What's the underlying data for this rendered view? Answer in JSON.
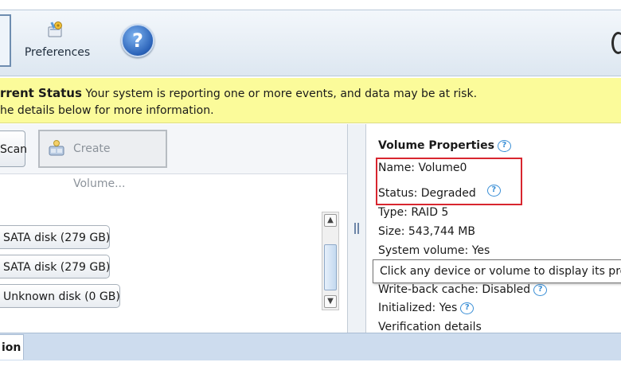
{
  "toolbar": {
    "preferences_label": "Preferences",
    "help_glyph": "?",
    "icons": [
      "preferences-icon",
      "help-icon"
    ]
  },
  "status": {
    "title": "rrent Status",
    "message": "Your system is reporting one or more events, and data may be at risk.",
    "line2": "he details below for more information."
  },
  "left": {
    "rescan_label": "Scan",
    "create_volume_label": "Create Volume...",
    "disks": [
      {
        "label": "SATA disk (279 GB)"
      },
      {
        "label": "SATA disk (279 GB)"
      },
      {
        "label": "Unknown disk (0 GB)"
      }
    ]
  },
  "properties": {
    "title": "Volume Properties",
    "name": "Name: Volume0",
    "status": "Status: Degraded",
    "type": "Type: RAID 5",
    "size": "Size: 543,744 MB",
    "system_volume": "System volume: Yes",
    "write_back": "Write-back cache: Disabled",
    "initialized": "Initialized: Yes",
    "verification": "Verification details"
  },
  "tooltip": "Click any device or volume to display its prop",
  "bottom_tab": "ion",
  "colors": {
    "banner": "#fbfb9a",
    "highlight": "#d8262f",
    "help_blue": "#2a62b8",
    "tab_bar": "#cddcee"
  }
}
